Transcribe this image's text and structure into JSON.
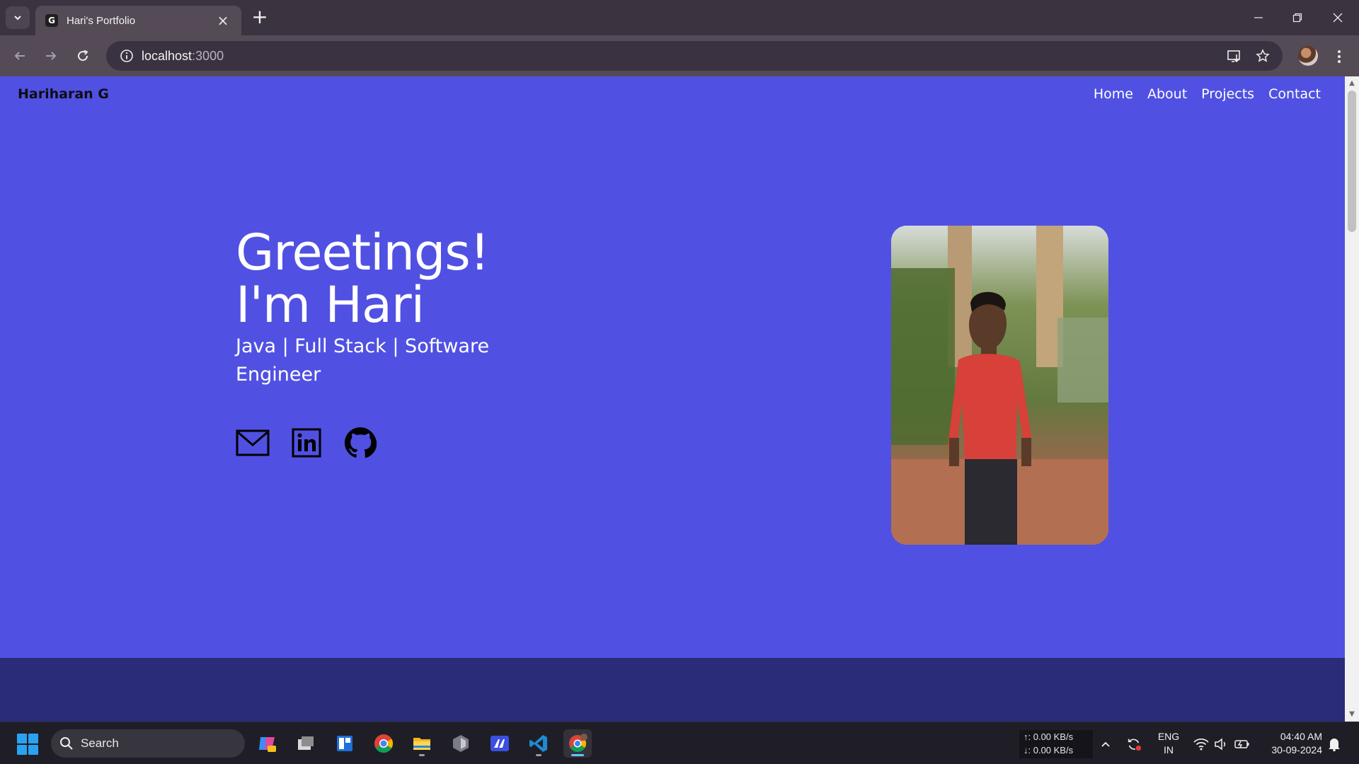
{
  "browser": {
    "tab_title": "Hari's Portfolio",
    "favicon_glyph": "G",
    "url_host": "localhost",
    "url_port": ":3000"
  },
  "site": {
    "brand": "Hariharan G",
    "nav": [
      "Home",
      "About",
      "Projects",
      "Contact"
    ],
    "hero_line1": "Greetings!",
    "hero_line2": "I'm Hari",
    "roles": "Java | Full Stack | Software Engineer",
    "socials": [
      "mail-icon",
      "linkedin-icon",
      "github-icon"
    ],
    "background_color": "#5051e2",
    "next_section_color": "#2a2c79"
  },
  "taskbar": {
    "search_label": "Search",
    "net_up": "↑: 0.00 KB/s",
    "net_down": "↓: 0.00 KB/s",
    "lang_line1": "ENG",
    "lang_line2": "IN",
    "time": "04:40 AM",
    "date": "30-09-2024"
  }
}
